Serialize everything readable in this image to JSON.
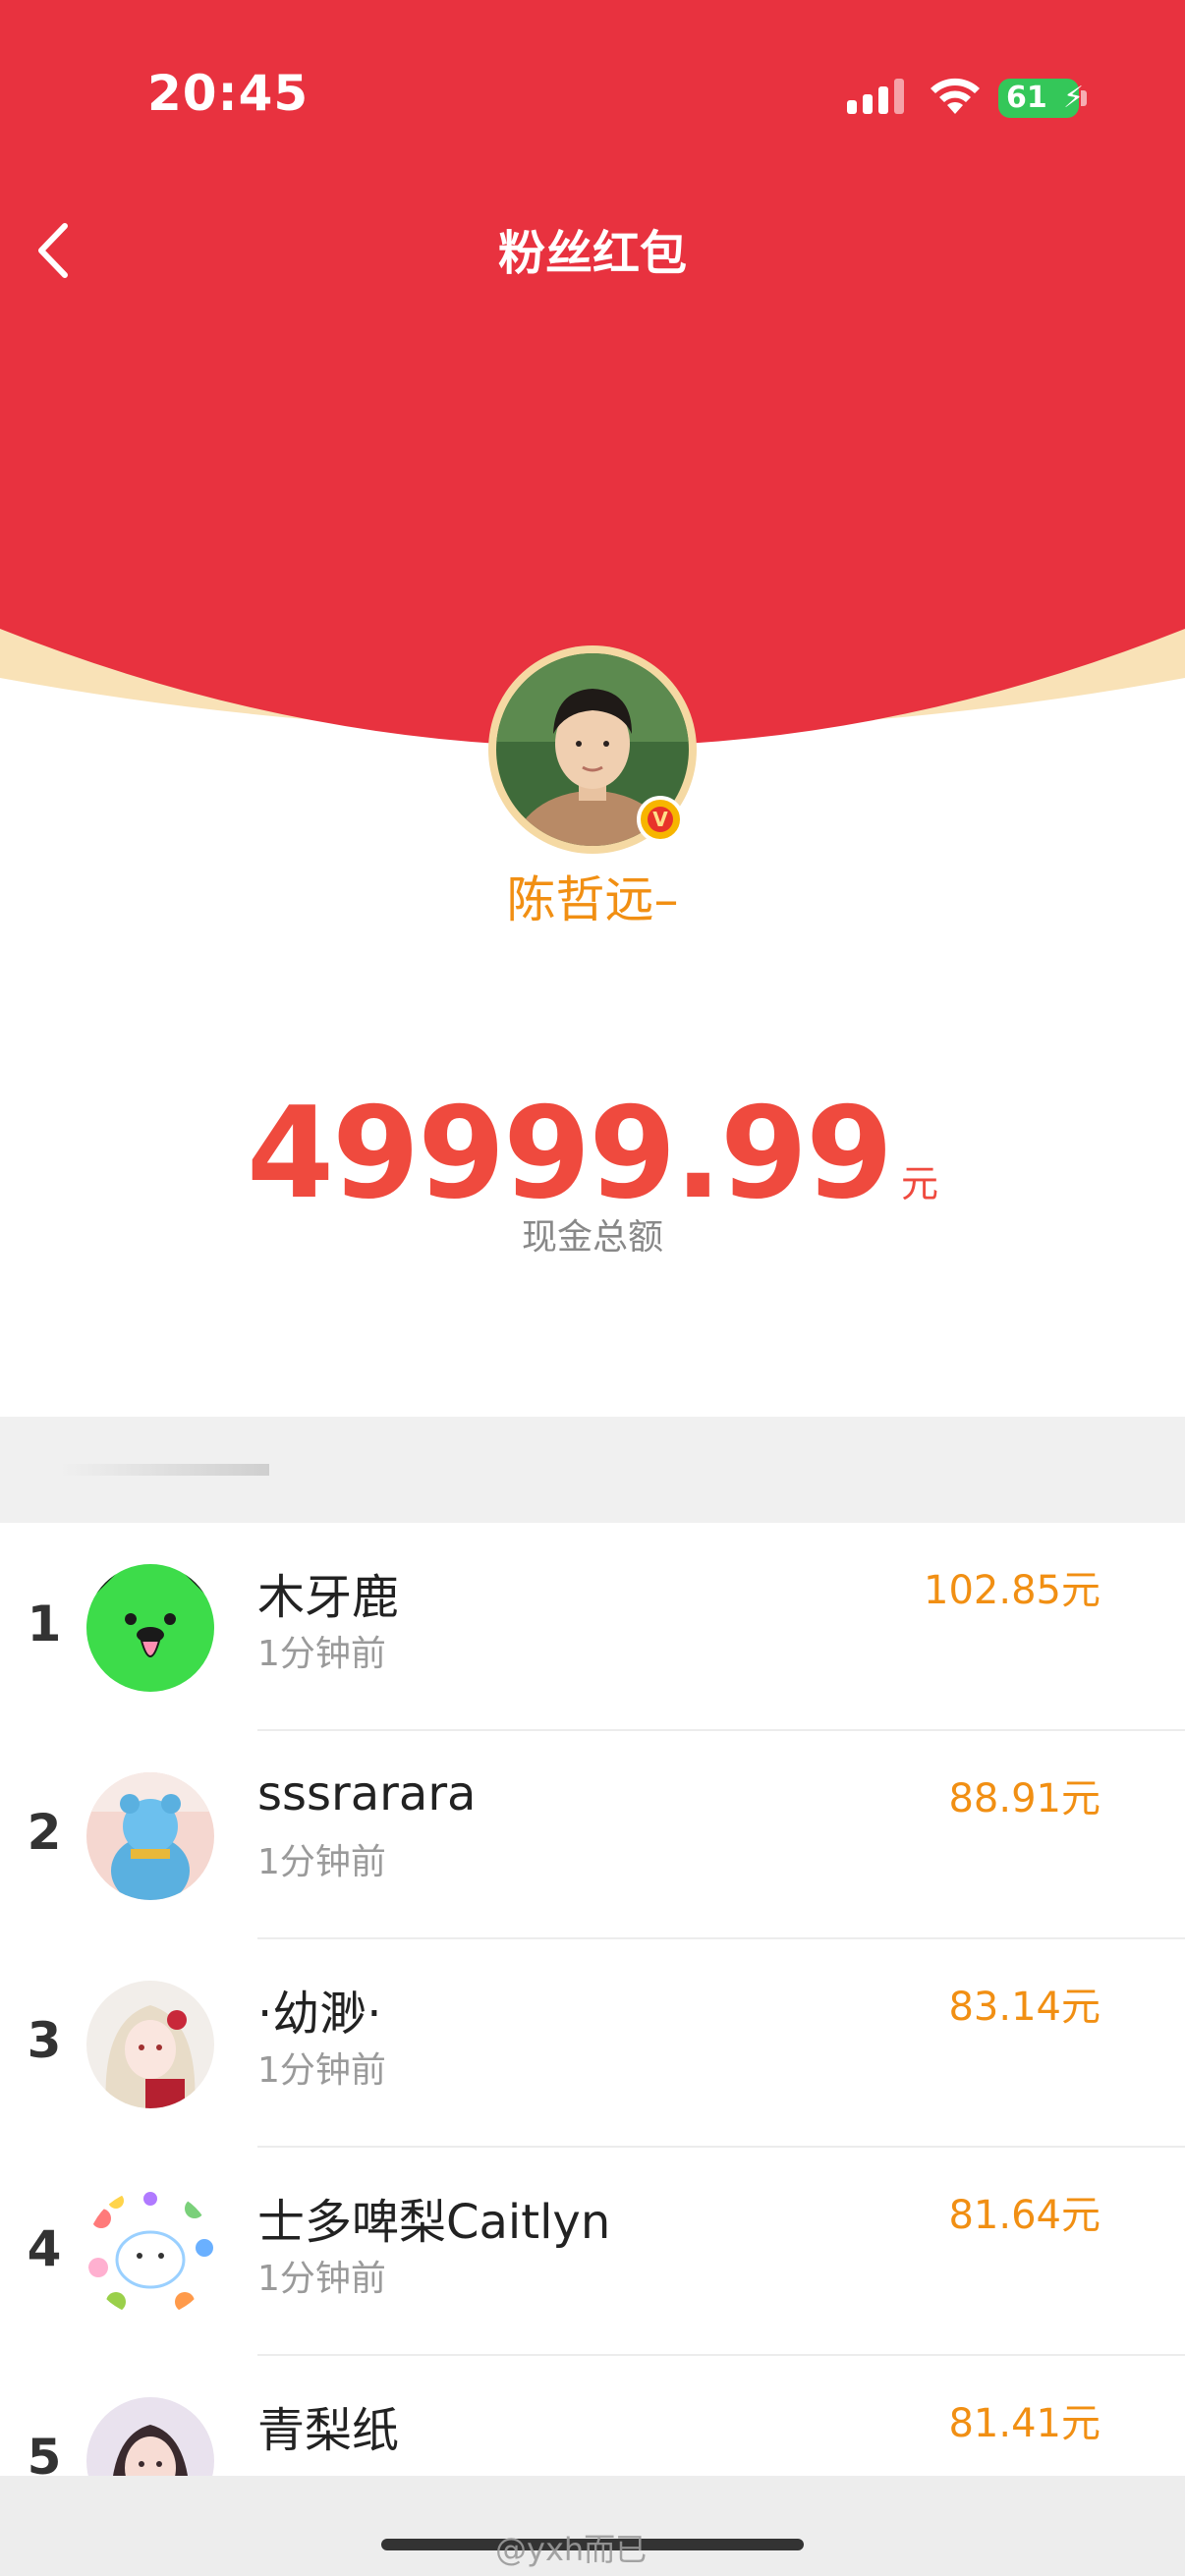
{
  "status_bar": {
    "time": "20:45",
    "battery": "61",
    "battery_color": "#34c759"
  },
  "header": {
    "title": "粉丝红包",
    "back_icon": "chevron-left-icon",
    "background_color": "#e8323f"
  },
  "sender": {
    "name": "陈哲远–",
    "verified_icon": "verified-v-icon"
  },
  "total": {
    "amount": "49999.99",
    "currency": "元",
    "label": "现金总额",
    "color": "#ef4a3e"
  },
  "recipients": [
    {
      "rank": "1",
      "name": "木牙鹿",
      "time": "1分钟前",
      "amount": "102.85元",
      "avatar_icon": "green-cartoon-avatar"
    },
    {
      "rank": "2",
      "name": "sssrarara",
      "time": "1分钟前",
      "amount": "88.91元",
      "avatar_icon": "blue-bear-avatar"
    },
    {
      "rank": "3",
      "name": "·幼渺·",
      "time": "1分钟前",
      "amount": "83.14元",
      "avatar_icon": "anime-girl-avatar"
    },
    {
      "rank": "4",
      "name": "士多啤梨Caitlyn",
      "time": "1分钟前",
      "amount": "81.64元",
      "avatar_icon": "colorful-rabbit-avatar"
    },
    {
      "rank": "5",
      "name": "青梨纸",
      "time": "",
      "amount": "81.41元",
      "avatar_icon": "girl-photo-avatar"
    }
  ],
  "watermark": "@yxh而已",
  "amount_color": "#f18f13"
}
